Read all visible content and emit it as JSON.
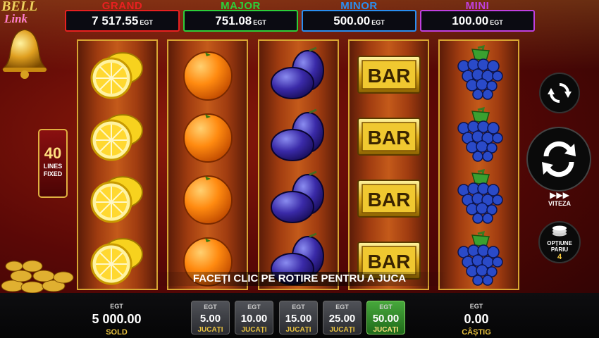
{
  "logo": {
    "line1": "BELL",
    "line2": "Link"
  },
  "jackpots": [
    {
      "name": "GRAND",
      "value": "7 517.55",
      "currency": "EGT",
      "color": "#e82020"
    },
    {
      "name": "MAJOR",
      "value": "751.08",
      "currency": "EGT",
      "color": "#2ccf3a"
    },
    {
      "name": "MINOR",
      "value": "500.00",
      "currency": "EGT",
      "color": "#2a8ef0"
    },
    {
      "name": "MINI",
      "value": "100.00",
      "currency": "EGT",
      "color": "#c040e0"
    }
  ],
  "lines": {
    "count": "40",
    "label1": "LINES",
    "label2": "FIXED"
  },
  "reels": [
    {
      "symbol": "lemon",
      "rows": [
        "lemon",
        "lemon",
        "lemon",
        "lemon"
      ]
    },
    {
      "symbol": "orange",
      "rows": [
        "orange",
        "orange",
        "orange",
        "orange"
      ]
    },
    {
      "symbol": "plum",
      "rows": [
        "plum",
        "plum",
        "plum",
        "plum"
      ]
    },
    {
      "symbol": "bar",
      "rows": [
        "BAR",
        "BAR",
        "BAR",
        "BAR"
      ]
    },
    {
      "symbol": "grapes",
      "rows": [
        "grapes",
        "grapes",
        "grapes",
        "grapes"
      ]
    }
  ],
  "controls": {
    "autoplay_icon": "autoplay-icon",
    "spin_icon": "spin-icon",
    "speed_label": "VITEZA",
    "bet_options_label1": "OPȚIUNE",
    "bet_options_label2": "PARIU",
    "bet_options_value": "4"
  },
  "message": "FACEȚI CLIC PE ROTIRE PENTRU A JUCA",
  "balance": {
    "currency": "EGT",
    "value": "5 000.00",
    "label": "SOLD"
  },
  "bets": [
    {
      "currency": "EGT",
      "value": "5.00",
      "label": "JUCAȚI",
      "selected": false
    },
    {
      "currency": "EGT",
      "value": "10.00",
      "label": "JUCAȚI",
      "selected": false
    },
    {
      "currency": "EGT",
      "value": "15.00",
      "label": "JUCAȚI",
      "selected": false
    },
    {
      "currency": "EGT",
      "value": "25.00",
      "label": "JUCAȚI",
      "selected": false
    },
    {
      "currency": "EGT",
      "value": "50.00",
      "label": "JUCAȚI",
      "selected": true
    }
  ],
  "win": {
    "currency": "EGT",
    "value": "0.00",
    "label": "CÂȘTIG"
  },
  "colors": {
    "reel_border": "#d8a632",
    "gold": "#e8c240",
    "selected_bet": "#47a83c"
  }
}
